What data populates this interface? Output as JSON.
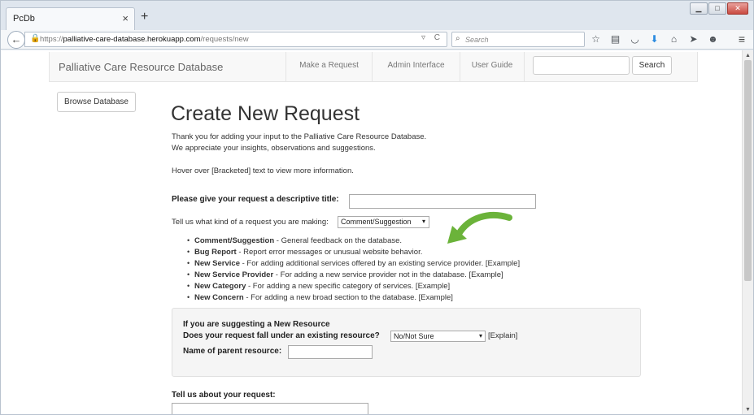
{
  "browser": {
    "tab_title": "PcDb",
    "tab_close": "×",
    "new_tab": "+",
    "url_prefix": "https://",
    "url_host": "palliative-care-database.herokuapp.com",
    "url_path": "/requests/new",
    "search_placeholder": "Search",
    "icons": [
      "star-icon",
      "reading-list-icon",
      "pocket-icon",
      "download-icon",
      "home-icon",
      "send-icon",
      "chat-icon"
    ],
    "window_controls": [
      "minimize",
      "maximize",
      "close"
    ]
  },
  "site": {
    "brand": "Palliative Care Resource Database",
    "nav": [
      "Make a Request",
      "Admin Interface",
      "User Guide"
    ],
    "search_button": "Search",
    "search_value": "",
    "browse_button": "Browse Database"
  },
  "main": {
    "title": "Create New Request",
    "intro_line1": "Thank you for adding your input to the Palliative Care Resource Database.",
    "intro_line2": "We appreciate your insights, observations and suggestions.",
    "hover_hint": "Hover over [Bracketed] text to view more information.",
    "title_label": "Please give your request a descriptive title:",
    "title_value": "",
    "kind_label": "Tell us what kind of a request you are making:",
    "kind_value": "Comment/Suggestion",
    "request_types": [
      {
        "name": "Comment/Suggestion",
        "desc": " - General feedback on the database."
      },
      {
        "name": "Bug Report",
        "desc": " - Report error messages or unusual website behavior."
      },
      {
        "name": "New Service",
        "desc": " - For adding additional services offered by an existing service provider. [Example]"
      },
      {
        "name": "New Service Provider",
        "desc": " - For adding a new service provider not in the database. [Example]"
      },
      {
        "name": "New Category",
        "desc": " - For adding a new specific category of services. [Example]"
      },
      {
        "name": "New Concern",
        "desc": " - For adding a new broad section to the database. [Example]"
      }
    ],
    "panel": {
      "heading": "If you are suggesting a New Resource",
      "existing_label": "Does your request fall under an existing resource?",
      "existing_value": "No/Not Sure",
      "explain": "[Explain]",
      "parent_label": "Name of parent resource:",
      "parent_value": ""
    },
    "about_label": "Tell us about your request:"
  },
  "colors": {
    "arrow": "#6bb33a",
    "navbar_bg": "#f8f8f8",
    "panel_bg": "#f5f5f5"
  }
}
